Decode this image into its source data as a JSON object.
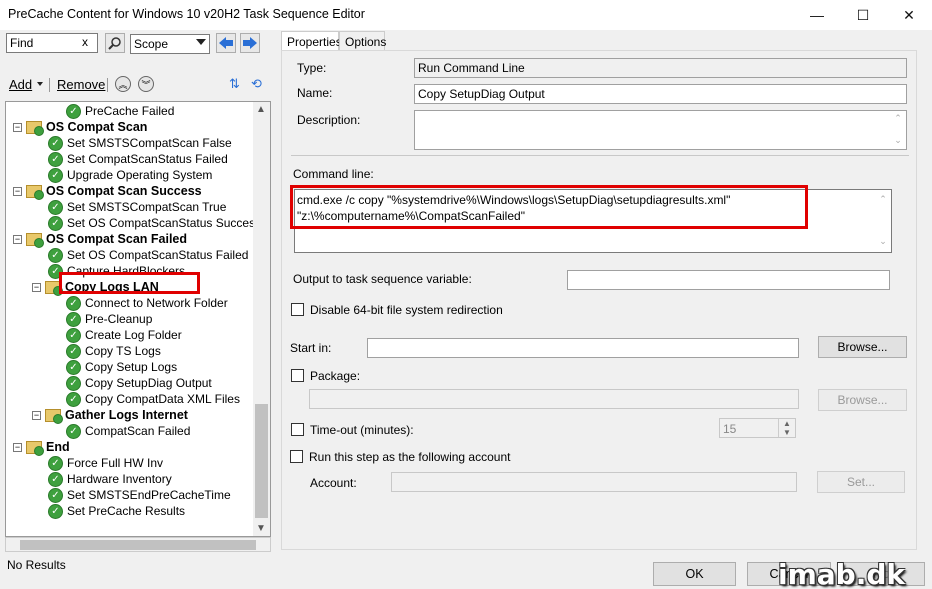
{
  "window": {
    "title": "PreCache Content for Windows 10 v20H2 Task Sequence Editor",
    "minimize": "—",
    "maximize": "☐",
    "close": "✕"
  },
  "toolbar": {
    "find_value": "Find",
    "find_clear": "x",
    "search_icon": "magnifier-icon",
    "scope_label": "Scope",
    "back_icon": "arrow-left-icon",
    "forward_icon": "arrow-right-icon"
  },
  "actions": {
    "add": "Add",
    "remove": "Remove"
  },
  "tree": {
    "items": [
      {
        "label": "PreCache Failed"
      },
      {
        "label": "OS Compat Scan"
      },
      {
        "label": "Set SMSTSCompatScan False"
      },
      {
        "label": "Set CompatScanStatus Failed"
      },
      {
        "label": "Upgrade Operating System"
      },
      {
        "label": "OS Compat Scan Success"
      },
      {
        "label": "Set SMSTSCompatScan True"
      },
      {
        "label": "Set OS CompatScanStatus Success"
      },
      {
        "label": "OS Compat Scan Failed"
      },
      {
        "label": "Set OS CompatScanStatus Failed"
      },
      {
        "label": "Capture HardBlockers"
      },
      {
        "label": "Copy Logs LAN"
      },
      {
        "label": "Connect to Network Folder"
      },
      {
        "label": "Pre-Cleanup"
      },
      {
        "label": "Create Log Folder"
      },
      {
        "label": "Copy TS Logs"
      },
      {
        "label": "Copy Setup Logs"
      },
      {
        "label": "Copy SetupDiag Output"
      },
      {
        "label": "Copy CompatData XML Files"
      },
      {
        "label": "Gather Logs Internet"
      },
      {
        "label": "CompatScan Failed"
      },
      {
        "label": "End"
      },
      {
        "label": "Force Full HW Inv"
      },
      {
        "label": "Hardware Inventory"
      },
      {
        "label": "Set SMSTSEndPreCacheTime"
      },
      {
        "label": "Set PreCache Results"
      }
    ]
  },
  "status": "No Results",
  "tabs": {
    "properties": "Properties",
    "options": "Options"
  },
  "properties": {
    "type_label": "Type:",
    "type_value": "Run Command Line",
    "name_label": "Name:",
    "name_value": "Copy SetupDiag Output",
    "description_label": "Description:",
    "description_value": "",
    "command_label": "Command line:",
    "command_value": "cmd.exe /c copy \"%systemdrive%\\Windows\\logs\\SetupDiag\\setupdiagresults.xml\" \"z:\\%computername%\\CompatScanFailed\"",
    "output_var_label": "Output to task sequence variable:",
    "output_var_value": "",
    "disable64_label": "Disable 64-bit file system redirection",
    "startin_label": "Start in:",
    "startin_value": "",
    "browse": "Browse...",
    "package_label": "Package:",
    "package_value": "",
    "browse2": "Browse...",
    "timeout_label": "Time-out (minutes):",
    "timeout_value": "15",
    "runas_label": "Run this step as the following account",
    "account_label": "Account:",
    "account_value": "",
    "set": "Set..."
  },
  "footer": {
    "ok": "OK",
    "cancel": "Cancel",
    "apply": "Apply"
  },
  "watermark": "imab.dk"
}
